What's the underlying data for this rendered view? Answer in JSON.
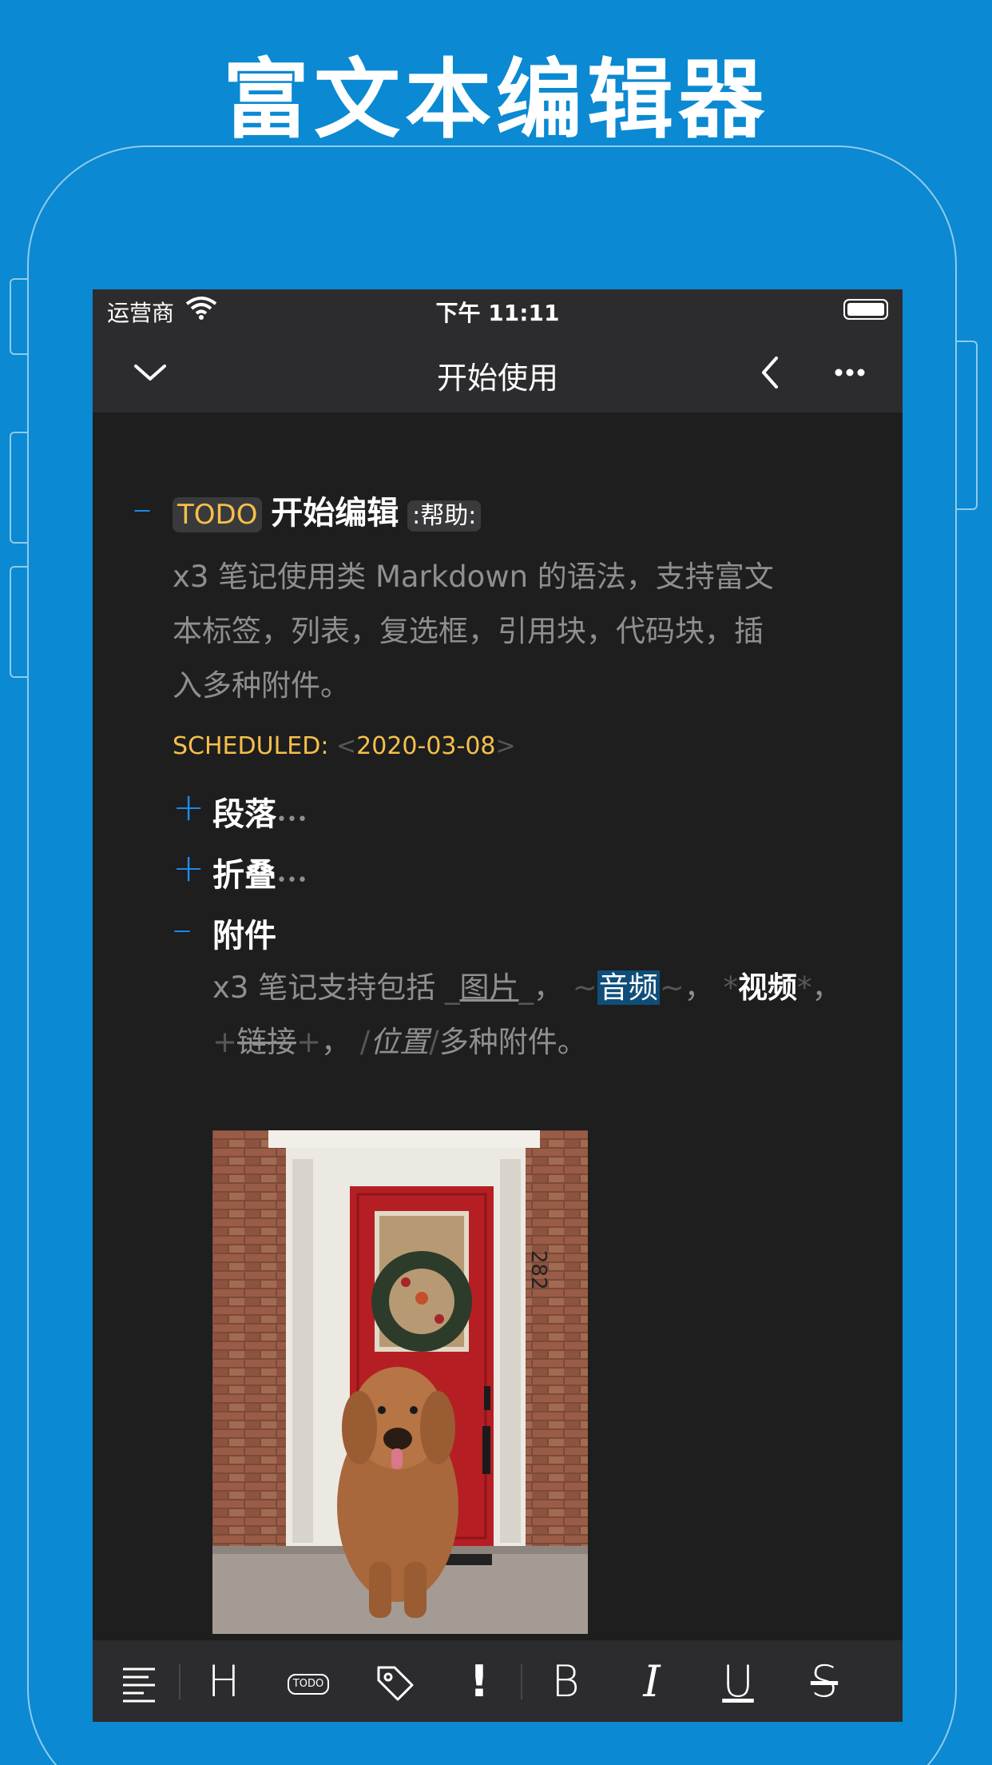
{
  "headline": "富文本编辑器",
  "status": {
    "carrier": "运营商",
    "time": "下午 11:11"
  },
  "nav": {
    "title": "开始使用"
  },
  "doc": {
    "todo_keyword": "TODO",
    "heading": "开始编辑",
    "tag": ":帮助:",
    "intro": [
      "x3 笔记使用类 Markdown 的语法，支持富文",
      "本标签，列表，复选框，引用块，代码块，插",
      "入多种附件。"
    ],
    "scheduled_label": "SCHEDULED:",
    "scheduled_open": "<",
    "scheduled_date": "2020-03-08",
    "scheduled_close": ">",
    "sections": [
      {
        "bullet": "+",
        "title": "段落",
        "ellipsis": "•••"
      },
      {
        "bullet": "+",
        "title": "折叠",
        "ellipsis": "•••"
      },
      {
        "bullet": "–",
        "title": "附件"
      }
    ],
    "attach_line1": {
      "prefix": "x3 笔记支持包括",
      "image_text": "图片",
      "image_marker": "_",
      "comma": "，",
      "audio_marker": "~",
      "audio_text": "音频",
      "video_marker": "*",
      "video_text": "视频"
    },
    "attach_line2": {
      "link_marker": "+",
      "link_text": "链接",
      "comma": "，",
      "loc_marker": "/",
      "loc_text": "位置",
      "suffix": "多种附件。"
    },
    "door_number": "282"
  },
  "toolbar": {
    "items": [
      "paragraph-icon",
      "heading-icon",
      "todo-icon",
      "tag-icon",
      "priority-icon",
      "bold-icon",
      "italic-icon",
      "underline-icon",
      "strikethrough-icon"
    ],
    "heading_label": "H",
    "todo_label": "TODO",
    "priority_label": "!",
    "bold_label": "B",
    "italic_label": "I",
    "underline_label": "U",
    "strike_label": "S"
  },
  "colors": {
    "background": "#0b89d2",
    "screen": "#1e1e1f",
    "accent_blue": "#1d8ef0",
    "todo_yellow": "#f5c04a"
  }
}
